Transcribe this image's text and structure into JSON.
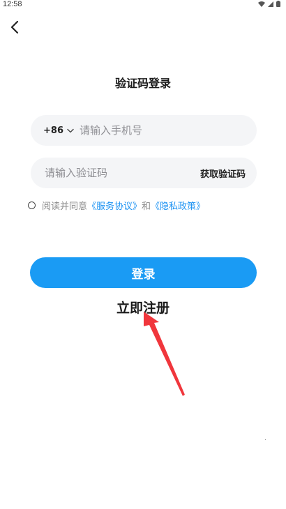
{
  "status_bar": {
    "time": "12:58",
    "icons": [
      "wifi-icon",
      "signal-icon",
      "battery-icon"
    ]
  },
  "header": {
    "back_icon": "chevron-left-icon"
  },
  "page": {
    "title": "验证码登录"
  },
  "phone": {
    "country_code": "+86",
    "placeholder": "请输入手机号",
    "value": ""
  },
  "code": {
    "placeholder": "请输入验证码",
    "value": "",
    "get_code_label": "获取验证码"
  },
  "agreement": {
    "checked": false,
    "prefix": "阅读并同意",
    "service_link": "《服务协议》",
    "and": "和",
    "privacy_link": "《隐私政策》"
  },
  "actions": {
    "login_label": "登录",
    "register_label": "立即注册"
  },
  "colors": {
    "accent": "#1a9bf4",
    "link": "#1d93f3",
    "field_bg": "#f4f5f7",
    "annotation_arrow": "#f0363c"
  }
}
